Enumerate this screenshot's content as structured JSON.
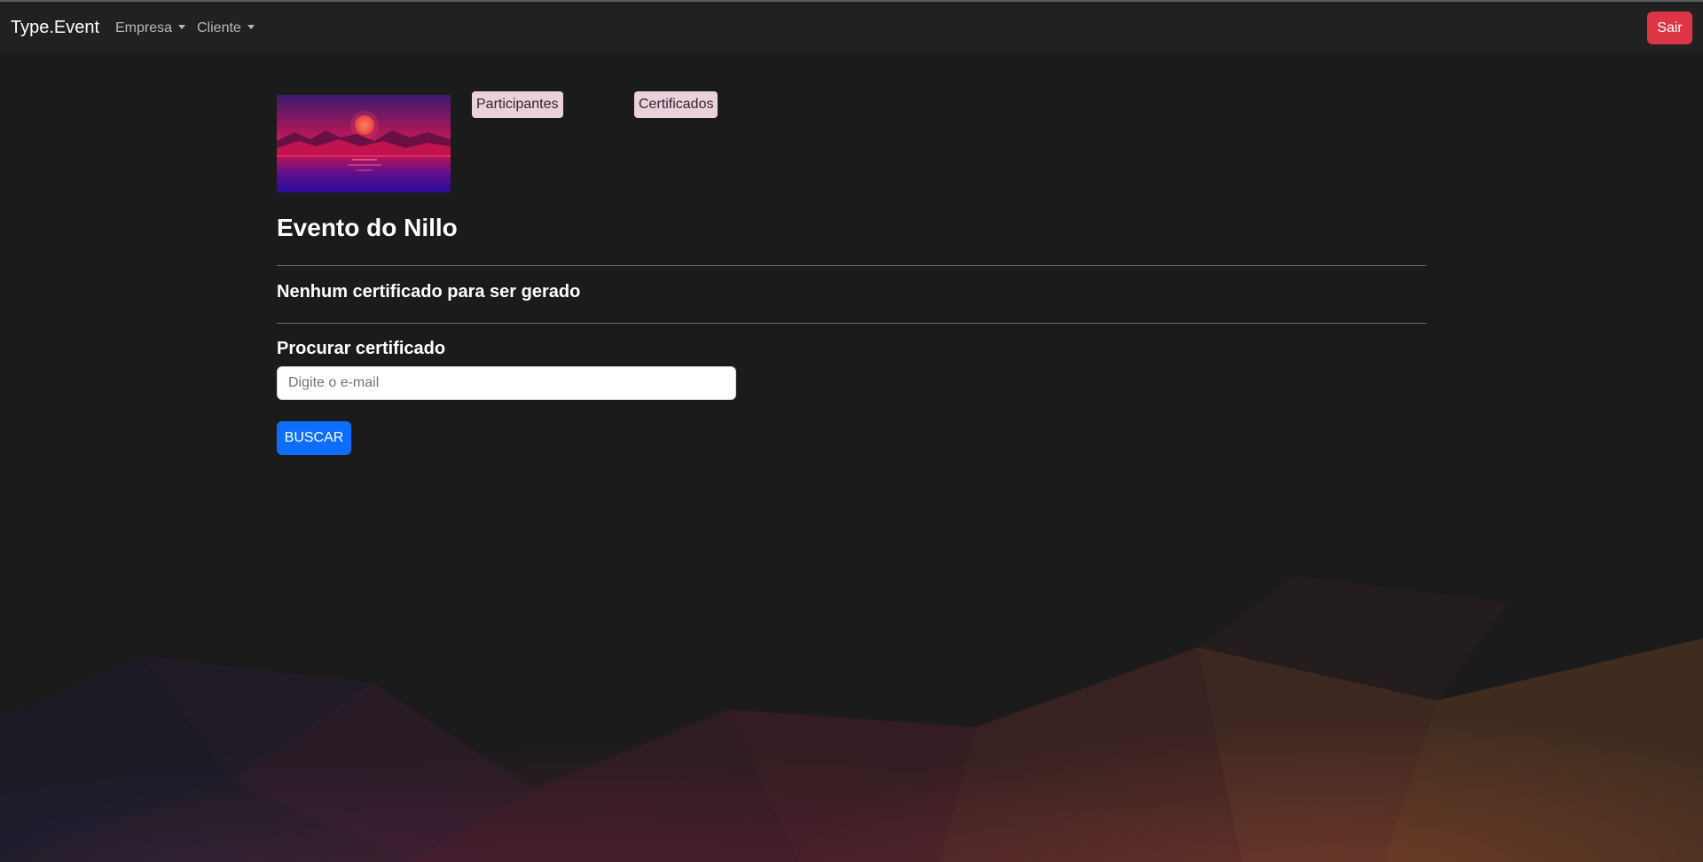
{
  "navbar": {
    "brand": "Type.Event",
    "menus": [
      {
        "label": "Empresa"
      },
      {
        "label": "Cliente"
      }
    ],
    "logout_label": "Sair"
  },
  "event": {
    "image_icon": "event-banner-moon-sunset-image",
    "tabs": [
      {
        "label": "Participantes"
      },
      {
        "label": "Certificados"
      }
    ],
    "title": "Evento do Nillo"
  },
  "certificates": {
    "empty_message": "Nenhum certificado para ser gerado"
  },
  "search": {
    "heading": "Procurar certificado",
    "placeholder": "Digite o e-mail",
    "value": "",
    "button_label": "BUSCAR"
  },
  "colors": {
    "navbar_bg": "#212121",
    "page_bg": "#1c1b1c",
    "danger": "#dc3545",
    "primary": "#0d6efd",
    "pill_bg": "#ead2dc"
  }
}
